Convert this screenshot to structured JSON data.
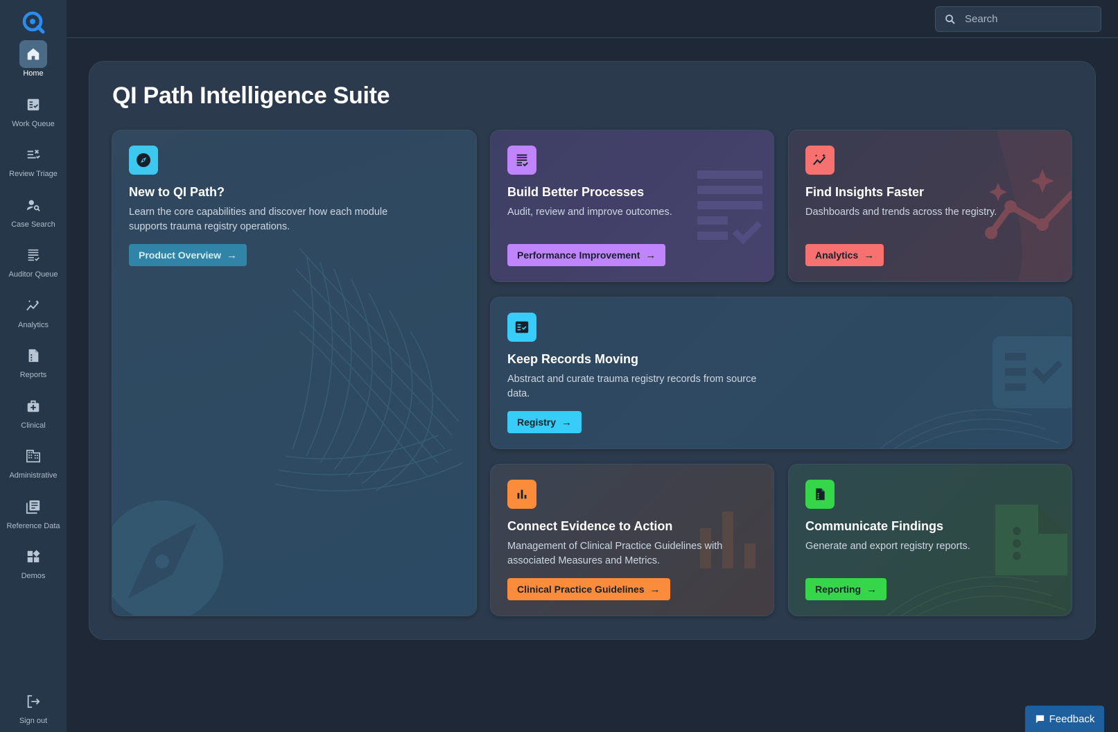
{
  "search": {
    "placeholder": "Search"
  },
  "page": {
    "title": "QI Path Intelligence Suite"
  },
  "sidebar": {
    "items": [
      {
        "label": "Home",
        "icon": "home-icon",
        "active": true
      },
      {
        "label": "Work Queue",
        "icon": "checklist-icon"
      },
      {
        "label": "Review Triage",
        "icon": "triage-icon"
      },
      {
        "label": "Case Search",
        "icon": "person-search-icon"
      },
      {
        "label": "Auditor Queue",
        "icon": "list-check-icon"
      },
      {
        "label": "Analytics",
        "icon": "trend-icon"
      },
      {
        "label": "Reports",
        "icon": "report-icon"
      },
      {
        "label": "Clinical",
        "icon": "medical-bag-icon"
      },
      {
        "label": "Administrative",
        "icon": "building-icon"
      },
      {
        "label": "Reference Data",
        "icon": "library-icon"
      },
      {
        "label": "Demos",
        "icon": "widgets-icon"
      }
    ],
    "signout": "Sign out"
  },
  "cards": {
    "overview": {
      "title": "New to QI Path?",
      "desc": "Learn the core capabilities and discover how each module supports trauma registry operations.",
      "button": "Product Overview",
      "accent": "#3ec7ef",
      "icon": "compass-icon"
    },
    "processes": {
      "title": "Build Better Processes",
      "desc": "Audit, review and improve outcomes.",
      "button": "Performance Improvement",
      "accent": "#c084fc",
      "icon": "list-check-icon"
    },
    "insights": {
      "title": "Find Insights Faster",
      "desc": "Dashboards and trends across the registry.",
      "button": "Analytics",
      "accent": "#f87171",
      "icon": "trend-icon"
    },
    "records": {
      "title": "Keep Records Moving",
      "desc": "Abstract and curate trauma registry records from source data.",
      "button": "Registry",
      "accent": "#38cdf8",
      "icon": "fact-check-icon"
    },
    "evidence": {
      "title": "Connect Evidence to Action",
      "desc": "Management of Clinical Practice Guidelines with associated Measures and Metrics.",
      "button": "Clinical Practice Guidelines",
      "accent": "#fb8c3c",
      "icon": "bar-chart-icon"
    },
    "findings": {
      "title": "Communicate Findings",
      "desc": "Generate and export registry reports.",
      "button": "Reporting",
      "accent": "#36d64a",
      "icon": "report-icon"
    }
  },
  "feedback": {
    "label": "Feedback"
  }
}
